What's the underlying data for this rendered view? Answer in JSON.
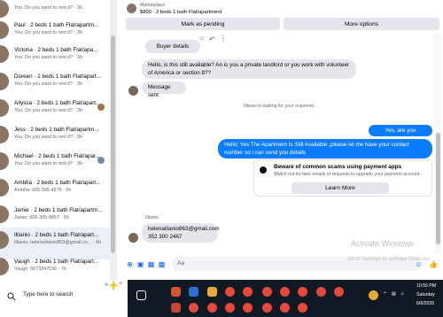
{
  "sidebar": {
    "conversations": [
      {
        "name": "",
        "preview": "You: Do you want to rent it? · 3h"
      },
      {
        "name": "Paul · 2 beds 1 bath Flat/apartm...",
        "preview": "You: Do you want to rent it? · 3h"
      },
      {
        "name": "Victoria · 2 beds 1 bath Flat/apa...",
        "preview": "You: Do you want to rent it? · 3h"
      },
      {
        "name": "Doreen · 2 beds 1 bath Flat/apart...",
        "preview": "You: Do you want to rent it? · 3h"
      },
      {
        "name": "Allyssa · 2 beds 1 bath Flat/apart...",
        "preview": "You: Do you want to rent it? · 3h"
      },
      {
        "name": "Jess · 2 beds 1 bath Flat/apartm...",
        "preview": "You: Do you want to rent it? · 3h"
      },
      {
        "name": "Michael · 2 beds 1 bath Flat/apar...",
        "preview": "You: Do you want to rent it? · 3h"
      },
      {
        "name": "Ambřiá · 2 beds 1 bath Flat/apart...",
        "preview": "Ambřiá: 605-305-4575 · 5h"
      },
      {
        "name": "Jamie · 2 beds 1 bath Flat/apartm...",
        "preview": "Jamie: 605-305-8857 · 5h"
      },
      {
        "name": "Illianio · 2 beds 1 bath Flat/apart...",
        "preview": "Illianio: helenailianio863@gmail.co... · 6h"
      },
      {
        "name": "Vaugh · 2 beds 1 bath Flat/apart...",
        "preview": "Vaugh: 6673347536 · 7h"
      }
    ]
  },
  "header": {
    "marketplace_label": "Marketplace",
    "listing_title": "$800 · 2 beds 1 bath Flat/apartment",
    "mark_pending": "Mark as pending",
    "more_options": "More options"
  },
  "chat": {
    "buyer_details": "Buyer details",
    "msg_in_1": "Hello, is this still available? An is you a private landlord or you work with volunteer of America or section 8??",
    "msg_in_2": "Message sent",
    "waiting": "Illianio is waiting for your response.",
    "msg_out_1": "Yes, are you interested?",
    "msg_out_2": "Hello; Yes The Apartment Is Still Available ,please let me have your contact number so i can send you details",
    "scam_title": "Beware of common scams using payment apps",
    "scam_body": "Watch out for fake emails or requests to upgrade your payment account.",
    "learn_more": "Learn More",
    "sender_name": "Illianio",
    "msg_in_3_line1": "helenailianio863@gmail.com",
    "msg_in_3_line2": "352 300 2467"
  },
  "composer": {
    "placeholder": "Aa"
  },
  "watermark": {
    "title": "Activate Windows",
    "subtitle": "Go to Settings to activate Windows."
  },
  "taskbar": {
    "search_placeholder": "Type here to search",
    "time": "10:55 PM",
    "day": "Saturday",
    "date": "6/6/2026"
  },
  "colors": {
    "messenger_blue": "#0a7cff",
    "taskbar": "#0f1a24"
  }
}
